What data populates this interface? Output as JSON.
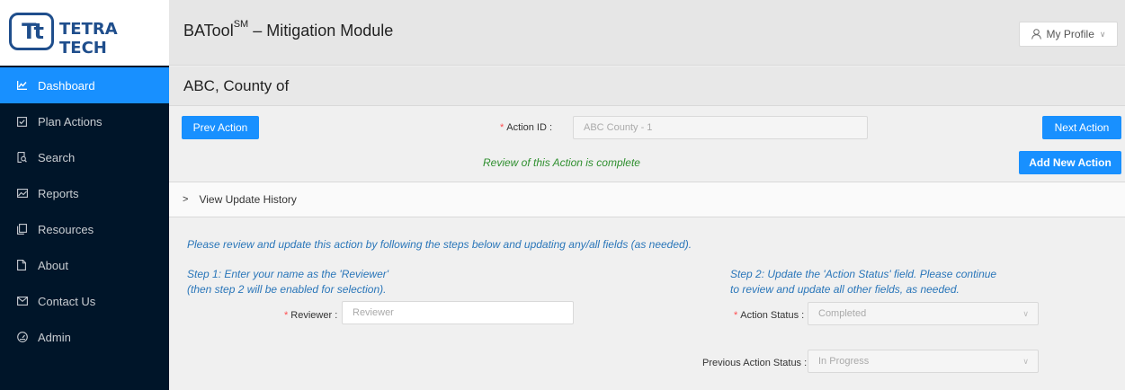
{
  "logo": {
    "mark": "Tt",
    "text": "TETRA TECH"
  },
  "sidebar": {
    "items": [
      {
        "label": "Dashboard",
        "icon": "chart-icon",
        "active": true
      },
      {
        "label": "Plan Actions",
        "icon": "checkbox-icon",
        "active": false
      },
      {
        "label": "Search",
        "icon": "file-search-icon",
        "active": false
      },
      {
        "label": "Reports",
        "icon": "picture-icon",
        "active": false
      },
      {
        "label": "Resources",
        "icon": "copy-icon",
        "active": false
      },
      {
        "label": "About",
        "icon": "file-icon",
        "active": false
      },
      {
        "label": "Contact Us",
        "icon": "mail-icon",
        "active": false
      },
      {
        "label": "Admin",
        "icon": "dashboard-gauge-icon",
        "active": false
      }
    ]
  },
  "header": {
    "title_prefix": "BATool",
    "title_sup": "SM",
    "title_suffix": " – Mitigation Module",
    "profile_label": "My Profile"
  },
  "subheader": {
    "county": "ABC, County of"
  },
  "action": {
    "prev_label": "Prev Action",
    "next_label": "Next Action",
    "add_label": "Add New Action",
    "id_label": "Action ID",
    "id_value": "ABC County - 1",
    "review_status": "Review of this Action is complete"
  },
  "history": {
    "label": "View Update History"
  },
  "form": {
    "instructions": "Please review and update this action by following the steps below and updating any/all fields (as needed).",
    "step1_line1": "Step 1: Enter your name as the 'Reviewer'",
    "step1_line2": "(then step 2 will be enabled for selection).",
    "step2_line1": "Step 2: Update the 'Action Status' field. Please continue",
    "step2_line2": "to review and update all other fields, as needed.",
    "reviewer_label": "Reviewer",
    "reviewer_placeholder": "Reviewer",
    "action_status_label": "Action Status",
    "action_status_value": "Completed",
    "prev_status_label": "Previous Action Status",
    "prev_status_value": "In Progress"
  },
  "colors": {
    "primary": "#1890ff",
    "sidebar": "#001529",
    "instruction_text": "#2a76b9",
    "success_text": "#2f8f2f"
  }
}
